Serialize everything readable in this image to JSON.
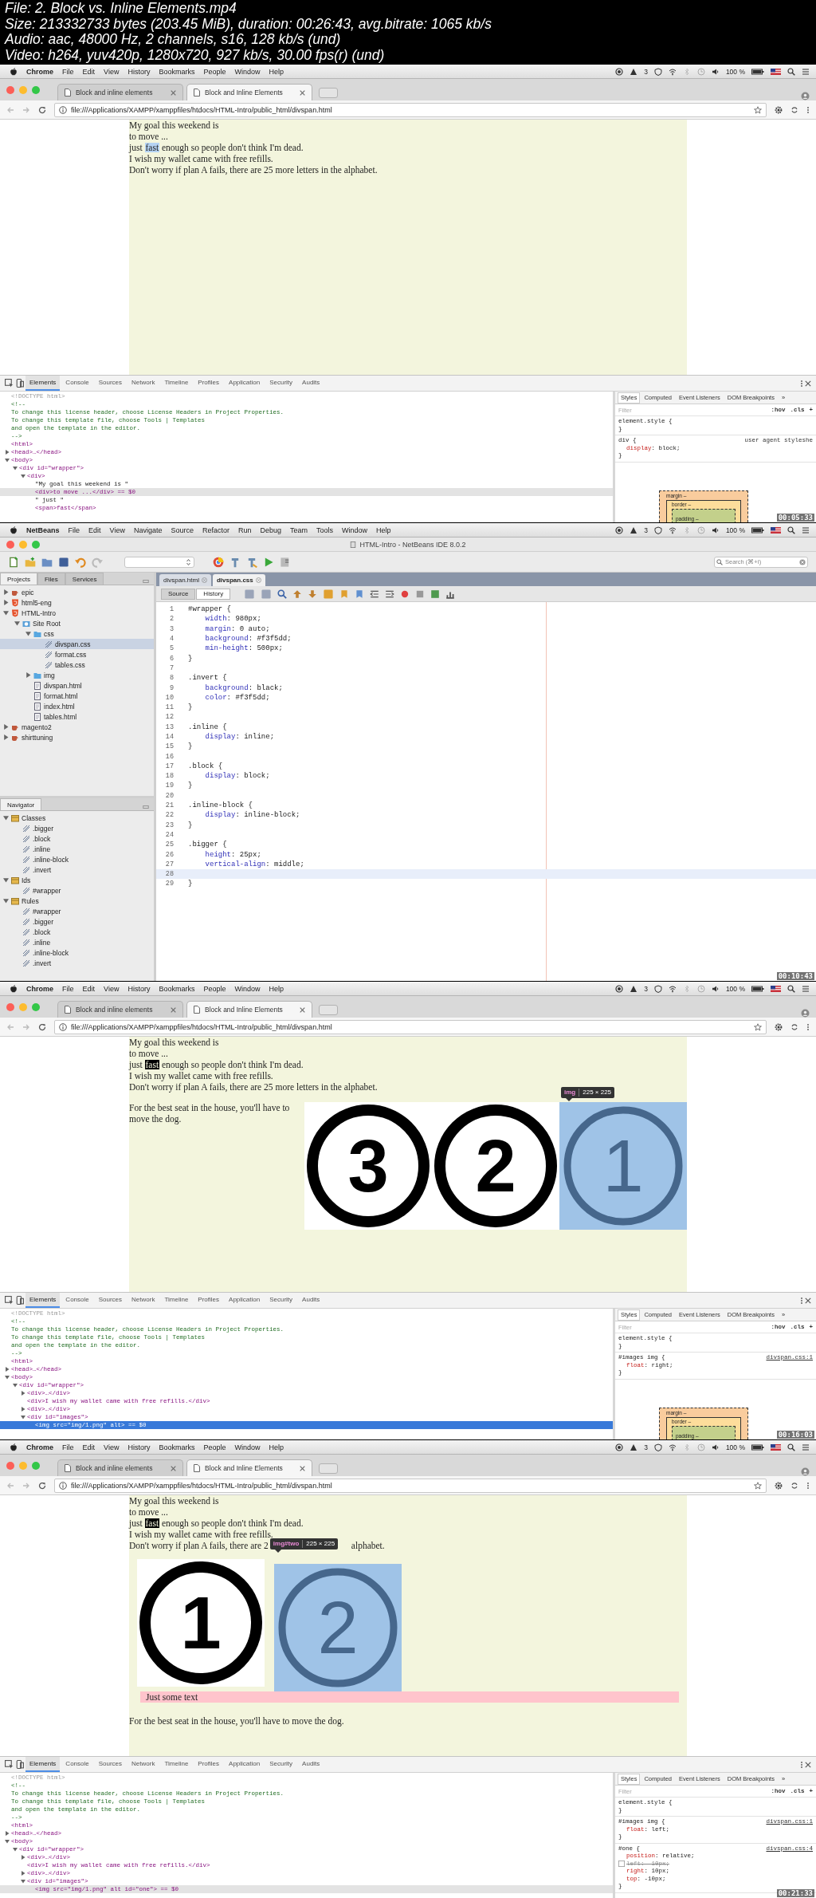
{
  "file_info": [
    "File: 2. Block vs. Inline Elements.mp4",
    "Size: 213332733 bytes (203.45 MiB), duration: 00:26:43, avg.bitrate: 1065 kb/s",
    "Audio: aac, 48000 Hz, 2 channels, s16, 128 kb/s (und)",
    "Video: h264, yuv420p, 1280x720, 927 kb/s, 30.00 fps(r) (und)"
  ],
  "frames": [
    {
      "kind": "chrome",
      "timestamp": "00:05:33",
      "menu_bar": {
        "app": "Chrome",
        "items": [
          "File",
          "Edit",
          "View",
          "History",
          "Bookmarks",
          "People",
          "Window",
          "Help"
        ],
        "badge": "3",
        "battery": "100 %"
      },
      "tabs": [
        {
          "label": "Block and inline elements",
          "selected": false
        },
        {
          "label": "Block and Inline Elements",
          "selected": true
        }
      ],
      "address": "file:///Applications/XAMPP/xamppfiles/htdocs/HTML-Intro/public_html/divspan.html",
      "page": {
        "lines": [
          [
            {
              "text": "My goal this weekend is"
            }
          ],
          [
            {
              "text": "to move ..."
            }
          ],
          [
            {
              "text": "just "
            },
            {
              "text": "fast",
              "kind": "selection"
            },
            {
              "text": " enough so people don't think I'm dead."
            }
          ],
          [
            {
              "text": "I wish my wallet came with free refills."
            }
          ],
          [
            {
              "text": "Don't worry if plan A fails, there are 25 more letters in the alphabet."
            }
          ]
        ]
      },
      "devtools": {
        "focused": false,
        "tabs": [
          {
            "label": "Elements",
            "selected": true
          },
          {
            "label": "Console",
            "selected": false
          },
          {
            "label": "Sources",
            "selected": false
          },
          {
            "label": "Network",
            "selected": false
          },
          {
            "label": "Timeline",
            "selected": false
          },
          {
            "label": "Profiles",
            "selected": false
          },
          {
            "label": "Application",
            "selected": false
          },
          {
            "label": "Security",
            "selected": false
          },
          {
            "label": "Audits",
            "selected": false
          }
        ],
        "dom": [
          {
            "text": "<!DOCTYPE html>",
            "kind": "doctype",
            "selected": false
          },
          {
            "text": "<!--",
            "kind": "comment",
            "selected": false
          },
          {
            "text": "To change this license header, choose License Headers in Project Properties.",
            "kind": "comment",
            "selected": false
          },
          {
            "text": "To change this template file, choose Tools | Templates",
            "kind": "comment",
            "selected": false
          },
          {
            "text": "and open the template in the editor.",
            "kind": "comment",
            "selected": false
          },
          {
            "text": "-->",
            "kind": "comment",
            "selected": false
          },
          {
            "text": "<html>",
            "kind": "tag",
            "selected": false,
            "children": [
              {
                "text": "<head>…</head>",
                "kind": "tag",
                "selected": false,
                "expanded": false
              },
              {
                "text": "<body>",
                "kind": "tag",
                "selected": false,
                "expanded": true,
                "children": [
                  {
                    "text": "<div id=\"wrapper\">",
                    "kind": "tag",
                    "selected": false,
                    "expanded": true,
                    "children": [
                      {
                        "text": "<div>",
                        "kind": "tag",
                        "selected": false,
                        "expanded": true,
                        "children": [
                          {
                            "text": "\"My goal this weekend is \"",
                            "kind": "text",
                            "selected": false
                          },
                          {
                            "text": "<div>to move ...</div> == $0",
                            "kind": "tag",
                            "selected": true
                          },
                          {
                            "text": "\" just \"",
                            "kind": "text",
                            "selected": false
                          },
                          {
                            "text": "<span>fast</span>",
                            "kind": "tag",
                            "selected": false
                          }
                        ]
                      }
                    ]
                  }
                ]
              }
            ]
          }
        ],
        "styles_tabs": [
          {
            "label": "Styles",
            "selected": true
          },
          {
            "label": "Computed",
            "selected": false
          },
          {
            "label": "Event Listeners",
            "selected": false
          },
          {
            "label": "DOM Breakpoints",
            "selected": false
          }
        ],
        "more": "»",
        "filter": {
          "placeholder": "Filter"
        },
        "filter_buttons": [
          ":hov",
          ".cls",
          "+"
        ],
        "rules": [
          {
            "selector": "element.style {",
            "close": "}"
          },
          {
            "selector": "div {",
            "source": "user agent styleshe",
            "props": [
              {
                "text": "display: block;",
                "disabled": false
              }
            ],
            "close": "}"
          }
        ],
        "box_model": [
          "margin –",
          "border –",
          "padding –"
        ]
      }
    },
    {
      "kind": "netbeans",
      "timestamp": "00:10:43",
      "menu_bar": {
        "app": "NetBeans",
        "items": [
          "File",
          "Edit",
          "View",
          "Navigate",
          "Source",
          "Refactor",
          "Run",
          "Debug",
          "Team",
          "Tools",
          "Window",
          "Help"
        ],
        "badge": "3",
        "battery": "100 %"
      },
      "title": "HTML-Intro - NetBeans IDE 8.0.2",
      "search": {
        "placeholder": "Search (⌘+I)"
      },
      "panel_tabs": [
        {
          "label": "Projects",
          "selected": true
        },
        {
          "label": "Files",
          "selected": false
        },
        {
          "label": "Services",
          "selected": false
        }
      ],
      "projects": [
        {
          "label": "epic",
          "kind": "project",
          "expanded": false,
          "selected": false
        },
        {
          "label": "html5-eng",
          "kind": "html5",
          "expanded": false,
          "selected": false
        },
        {
          "label": "HTML-Intro",
          "kind": "html5",
          "expanded": true,
          "selected": false,
          "children": [
            {
              "label": "Site Root",
              "kind": "site",
              "expanded": true,
              "selected": false,
              "children": [
                {
                  "label": "css",
                  "kind": "folder",
                  "expanded": true,
                  "selected": false,
                  "children": [
                    {
                      "label": "divspan.css",
                      "kind": "css",
                      "selected": true
                    },
                    {
                      "label": "format.css",
                      "kind": "css",
                      "selected": false
                    },
                    {
                      "label": "tables.css",
                      "kind": "css",
                      "selected": false
                    }
                  ]
                },
                {
                  "label": "img",
                  "kind": "folder",
                  "expanded": false,
                  "selected": false
                },
                {
                  "label": "divspan.html",
                  "kind": "html",
                  "selected": false
                },
                {
                  "label": "format.html",
                  "kind": "html",
                  "selected": false
                },
                {
                  "label": "index.html",
                  "kind": "html",
                  "selected": false
                },
                {
                  "label": "tables.html",
                  "kind": "html",
                  "selected": false
                }
              ]
            }
          ]
        },
        {
          "label": "magento2",
          "kind": "project",
          "expanded": false,
          "selected": false
        },
        {
          "label": "shirttuning",
          "kind": "project",
          "expanded": false,
          "selected": false
        }
      ],
      "navigator": {
        "title": "Navigator",
        "tree": [
          {
            "label": "Classes",
            "kind": "group",
            "expanded": true,
            "children": [
              {
                "label": ".bigger",
                "kind": "rule"
              },
              {
                "label": ".block",
                "kind": "rule"
              },
              {
                "label": ".inline",
                "kind": "rule"
              },
              {
                "label": ".inline-block",
                "kind": "rule"
              },
              {
                "label": ".invert",
                "kind": "rule"
              }
            ]
          },
          {
            "label": "Ids",
            "kind": "group",
            "expanded": true,
            "children": [
              {
                "label": "#wrapper",
                "kind": "rule"
              }
            ]
          },
          {
            "label": "Rules",
            "kind": "group",
            "expanded": true,
            "children": [
              {
                "label": "#wrapper",
                "kind": "rule"
              },
              {
                "label": ".bigger",
                "kind": "rule"
              },
              {
                "label": ".block",
                "kind": "rule"
              },
              {
                "label": ".inline",
                "kind": "rule"
              },
              {
                "label": ".inline-block",
                "kind": "rule"
              },
              {
                "label": ".invert",
                "kind": "rule"
              }
            ]
          }
        ]
      },
      "editor_tabs": [
        {
          "label": "divspan.html",
          "selected": false
        },
        {
          "label": "divspan.css",
          "selected": true
        }
      ],
      "view_buttons": [
        {
          "label": "Source",
          "selected": true
        },
        {
          "label": "History",
          "selected": false
        }
      ],
      "code": [
        {
          "number": "1",
          "text": "#wrapper {",
          "current": false
        },
        {
          "number": "2",
          "text": "    width: 980px;",
          "current": false
        },
        {
          "number": "3",
          "text": "    margin: 0 auto;",
          "current": false
        },
        {
          "number": "4",
          "text": "    background: #f3f5dd;",
          "current": false
        },
        {
          "number": "5",
          "text": "    min-height: 500px;",
          "current": false
        },
        {
          "number": "6",
          "text": "}",
          "current": false
        },
        {
          "number": "7",
          "current": false
        },
        {
          "number": "8",
          "text": ".invert {",
          "current": false
        },
        {
          "number": "9",
          "text": "    background: black;",
          "current": false
        },
        {
          "number": "10",
          "text": "    color: #f3f5dd;",
          "current": false
        },
        {
          "number": "11",
          "text": "}",
          "current": false
        },
        {
          "number": "12",
          "current": false
        },
        {
          "number": "13",
          "text": ".inline {",
          "current": false
        },
        {
          "number": "14",
          "text": "    display: inline;",
          "current": false
        },
        {
          "number": "15",
          "text": "}",
          "current": false
        },
        {
          "number": "16",
          "current": false
        },
        {
          "number": "17",
          "text": ".block {",
          "current": false
        },
        {
          "number": "18",
          "text": "    display: block;",
          "current": false
        },
        {
          "number": "19",
          "text": "}",
          "current": false
        },
        {
          "number": "20",
          "current": false
        },
        {
          "number": "21",
          "text": ".inline-block {",
          "current": false
        },
        {
          "number": "22",
          "text": "    display: inline-block;",
          "current": false
        },
        {
          "number": "23",
          "text": "}",
          "current": false
        },
        {
          "number": "24",
          "current": false
        },
        {
          "number": "25",
          "text": ".bigger {",
          "current": false
        },
        {
          "number": "26",
          "text": "    height: 25px;",
          "current": false
        },
        {
          "number": "27",
          "text": "    vertical-align: middle;",
          "current": false
        },
        {
          "number": "28",
          "current": true
        },
        {
          "number": "29",
          "text": "}",
          "current": false
        }
      ]
    },
    {
      "kind": "chrome",
      "timestamp": "00:16:03",
      "menu_bar": {
        "app": "Chrome",
        "items": [
          "File",
          "Edit",
          "View",
          "History",
          "Bookmarks",
          "People",
          "Window",
          "Help"
        ],
        "badge": "3",
        "battery": "100 %"
      },
      "tabs": [
        {
          "label": "Block and inline elements",
          "selected": false
        },
        {
          "label": "Block and Inline Elements",
          "selected": true
        }
      ],
      "address": "file:///Applications/XAMPP/xamppfiles/htdocs/HTML-Intro/public_html/divspan.html",
      "page": {
        "lines": [
          [
            {
              "text": "My goal this weekend is"
            }
          ],
          [
            {
              "text": "to move ..."
            }
          ],
          [
            {
              "text": "just "
            },
            {
              "text": "fast",
              "kind": "invert"
            },
            {
              "text": " enough so people don't think I'm dead."
            }
          ],
          [
            {
              "text": "I wish my wallet came with free refills."
            }
          ],
          [
            {
              "text": "Don't worry if plan A fails, there are 25 more letters in the alphabet."
            }
          ]
        ],
        "float_text": "For the best seat in the house, you'll have to move the dog.",
        "images": [
          {
            "number": "3",
            "highlighted": false
          },
          {
            "number": "2",
            "highlighted": false
          },
          {
            "number": "1",
            "highlighted": true
          }
        ],
        "tooltip": {
          "selector": "img",
          "size": "225 × 225"
        }
      },
      "devtools": {
        "focused": true,
        "tabs": [
          {
            "label": "Elements",
            "selected": true
          },
          {
            "label": "Console",
            "selected": false
          },
          {
            "label": "Sources",
            "selected": false
          },
          {
            "label": "Network",
            "selected": false
          },
          {
            "label": "Timeline",
            "selected": false
          },
          {
            "label": "Profiles",
            "selected": false
          },
          {
            "label": "Application",
            "selected": false
          },
          {
            "label": "Security",
            "selected": false
          },
          {
            "label": "Audits",
            "selected": false
          }
        ],
        "dom": [
          {
            "text": "<!DOCTYPE html>",
            "kind": "doctype",
            "selected": false
          },
          {
            "text": "<!--",
            "kind": "comment",
            "selected": false
          },
          {
            "text": "To change this license header, choose License Headers in Project Properties.",
            "kind": "comment",
            "selected": false
          },
          {
            "text": "To change this template file, choose Tools | Templates",
            "kind": "comment",
            "selected": false
          },
          {
            "text": "and open the template in the editor.",
            "kind": "comment",
            "selected": false
          },
          {
            "text": "-->",
            "kind": "comment",
            "selected": false
          },
          {
            "text": "<html>",
            "kind": "tag",
            "selected": false,
            "children": [
              {
                "text": "<head>…</head>",
                "kind": "tag",
                "selected": false,
                "expanded": false
              },
              {
                "text": "<body>",
                "kind": "tag",
                "selected": false,
                "expanded": true,
                "children": [
                  {
                    "text": "<div id=\"wrapper\">",
                    "kind": "tag",
                    "selected": false,
                    "expanded": true,
                    "children": [
                      {
                        "text": "<div>…</div>",
                        "kind": "tag",
                        "selected": false,
                        "expanded": false
                      },
                      {
                        "text": "<div>I wish my wallet came with free refills.</div>",
                        "kind": "tag",
                        "selected": false
                      },
                      {
                        "text": "<div>…</div>",
                        "kind": "tag",
                        "selected": false,
                        "expanded": false
                      },
                      {
                        "text": "<div id=\"images\">",
                        "kind": "tag",
                        "selected": false,
                        "expanded": true,
                        "children": [
                          {
                            "text": "<img src=\"img/1.png\" alt> == $0",
                            "kind": "tag",
                            "selected": true
                          }
                        ]
                      }
                    ]
                  }
                ]
              }
            ]
          }
        ],
        "styles_tabs": [
          {
            "label": "Styles",
            "selected": true
          },
          {
            "label": "Computed",
            "selected": false
          },
          {
            "label": "Event Listeners",
            "selected": false
          },
          {
            "label": "DOM Breakpoints",
            "selected": false
          }
        ],
        "more": "»",
        "filter": {
          "placeholder": "Filter"
        },
        "filter_buttons": [
          ":hov",
          ".cls",
          "+"
        ],
        "rules": [
          {
            "selector": "element.style {",
            "close": "}"
          },
          {
            "selector": "#images img {",
            "source": "divspan.css:1",
            "props": [
              {
                "text": "float: right;",
                "disabled": false
              }
            ],
            "close": "}"
          }
        ],
        "box_model": [
          "margin –",
          "border –",
          "padding –"
        ]
      }
    },
    {
      "kind": "chrome",
      "timestamp": "00:21:33",
      "menu_bar": {
        "app": "Chrome",
        "items": [
          "File",
          "Edit",
          "View",
          "History",
          "Bookmarks",
          "People",
          "Window",
          "Help"
        ],
        "badge": "3",
        "battery": "100 %"
      },
      "tabs": [
        {
          "label": "Block and inline elements",
          "selected": false
        },
        {
          "label": "Block and Inline Elements",
          "selected": true
        }
      ],
      "address": "file:///Applications/XAMPP/xamppfiles/htdocs/HTML-Intro/public_html/divspan.html",
      "page": {
        "lines": [
          [
            {
              "text": "My goal this weekend is"
            }
          ],
          [
            {
              "text": "to move ..."
            }
          ],
          [
            {
              "text": "just "
            },
            {
              "text": "fast",
              "kind": "invert"
            },
            {
              "text": " enough so people don't think I'm dead."
            }
          ],
          [
            {
              "text": "I wish my wallet came with free refills."
            }
          ],
          [
            {
              "text": "Don't worry if plan A fails, there are 2"
            },
            {
              "kind": "gap"
            },
            {
              "text": "alphabet."
            }
          ]
        ],
        "images": [
          {
            "number": "1",
            "highlighted": false
          },
          {
            "number": "2",
            "highlighted": true
          }
        ],
        "tooltip": {
          "selector": "img#two",
          "size": "225 × 225"
        },
        "banner": "Just some text",
        "paragraph": "For the best seat in the house, you'll have to move the dog."
      },
      "devtools": {
        "focused": false,
        "tabs": [
          {
            "label": "Elements",
            "selected": true
          },
          {
            "label": "Console",
            "selected": false
          },
          {
            "label": "Sources",
            "selected": false
          },
          {
            "label": "Network",
            "selected": false
          },
          {
            "label": "Timeline",
            "selected": false
          },
          {
            "label": "Profiles",
            "selected": false
          },
          {
            "label": "Application",
            "selected": false
          },
          {
            "label": "Security",
            "selected": false
          },
          {
            "label": "Audits",
            "selected": false
          }
        ],
        "dom": [
          {
            "text": "<!DOCTYPE html>",
            "kind": "doctype",
            "selected": false
          },
          {
            "text": "<!--",
            "kind": "comment",
            "selected": false
          },
          {
            "text": "To change this license header, choose License Headers in Project Properties.",
            "kind": "comment",
            "selected": false
          },
          {
            "text": "To change this template file, choose Tools | Templates",
            "kind": "comment",
            "selected": false
          },
          {
            "text": "and open the template in the editor.",
            "kind": "comment",
            "selected": false
          },
          {
            "text": "-->",
            "kind": "comment",
            "selected": false
          },
          {
            "text": "<html>",
            "kind": "tag",
            "selected": false,
            "children": [
              {
                "text": "<head>…</head>",
                "kind": "tag",
                "selected": false,
                "expanded": false
              },
              {
                "text": "<body>",
                "kind": "tag",
                "selected": false,
                "expanded": true,
                "children": [
                  {
                    "text": "<div id=\"wrapper\">",
                    "kind": "tag",
                    "selected": false,
                    "expanded": true,
                    "children": [
                      {
                        "text": "<div>…</div>",
                        "kind": "tag",
                        "selected": false,
                        "expanded": false
                      },
                      {
                        "text": "<div>I wish my wallet came with free refills.</div>",
                        "kind": "tag",
                        "selected": false
                      },
                      {
                        "text": "<div>…</div>",
                        "kind": "tag",
                        "selected": false,
                        "expanded": false
                      },
                      {
                        "text": "<div id=\"images\">",
                        "kind": "tag",
                        "selected": false,
                        "expanded": true,
                        "children": [
                          {
                            "text": "<img src=\"img/1.png\" alt id=\"one\"> == $0",
                            "kind": "tag",
                            "selected": true
                          }
                        ]
                      }
                    ]
                  }
                ]
              }
            ]
          }
        ],
        "styles_tabs": [
          {
            "label": "Styles",
            "selected": true
          },
          {
            "label": "Computed",
            "selected": false
          },
          {
            "label": "Event Listeners",
            "selected": false
          },
          {
            "label": "DOM Breakpoints",
            "selected": false
          }
        ],
        "more": "»",
        "filter": {
          "placeholder": "Filter"
        },
        "filter_buttons": [
          ":hov",
          ".cls",
          "+"
        ],
        "rules": [
          {
            "selector": "element.style {",
            "close": "}"
          },
          {
            "selector": "#images img {",
            "source": "divspan.css:1",
            "props": [
              {
                "text": "float: left;",
                "disabled": false
              }
            ],
            "close": "}"
          },
          {
            "selector": "#one {",
            "source": "divspan.css:4",
            "props": [
              {
                "text": "position: relative;",
                "disabled": false
              },
              {
                "text": "left: -10px;",
                "disabled": true
              },
              {
                "text": "right: 10px;",
                "disabled": false
              },
              {
                "text": "top: -10px;",
                "disabled": false
              }
            ],
            "close": "}"
          }
        ]
      }
    }
  ]
}
